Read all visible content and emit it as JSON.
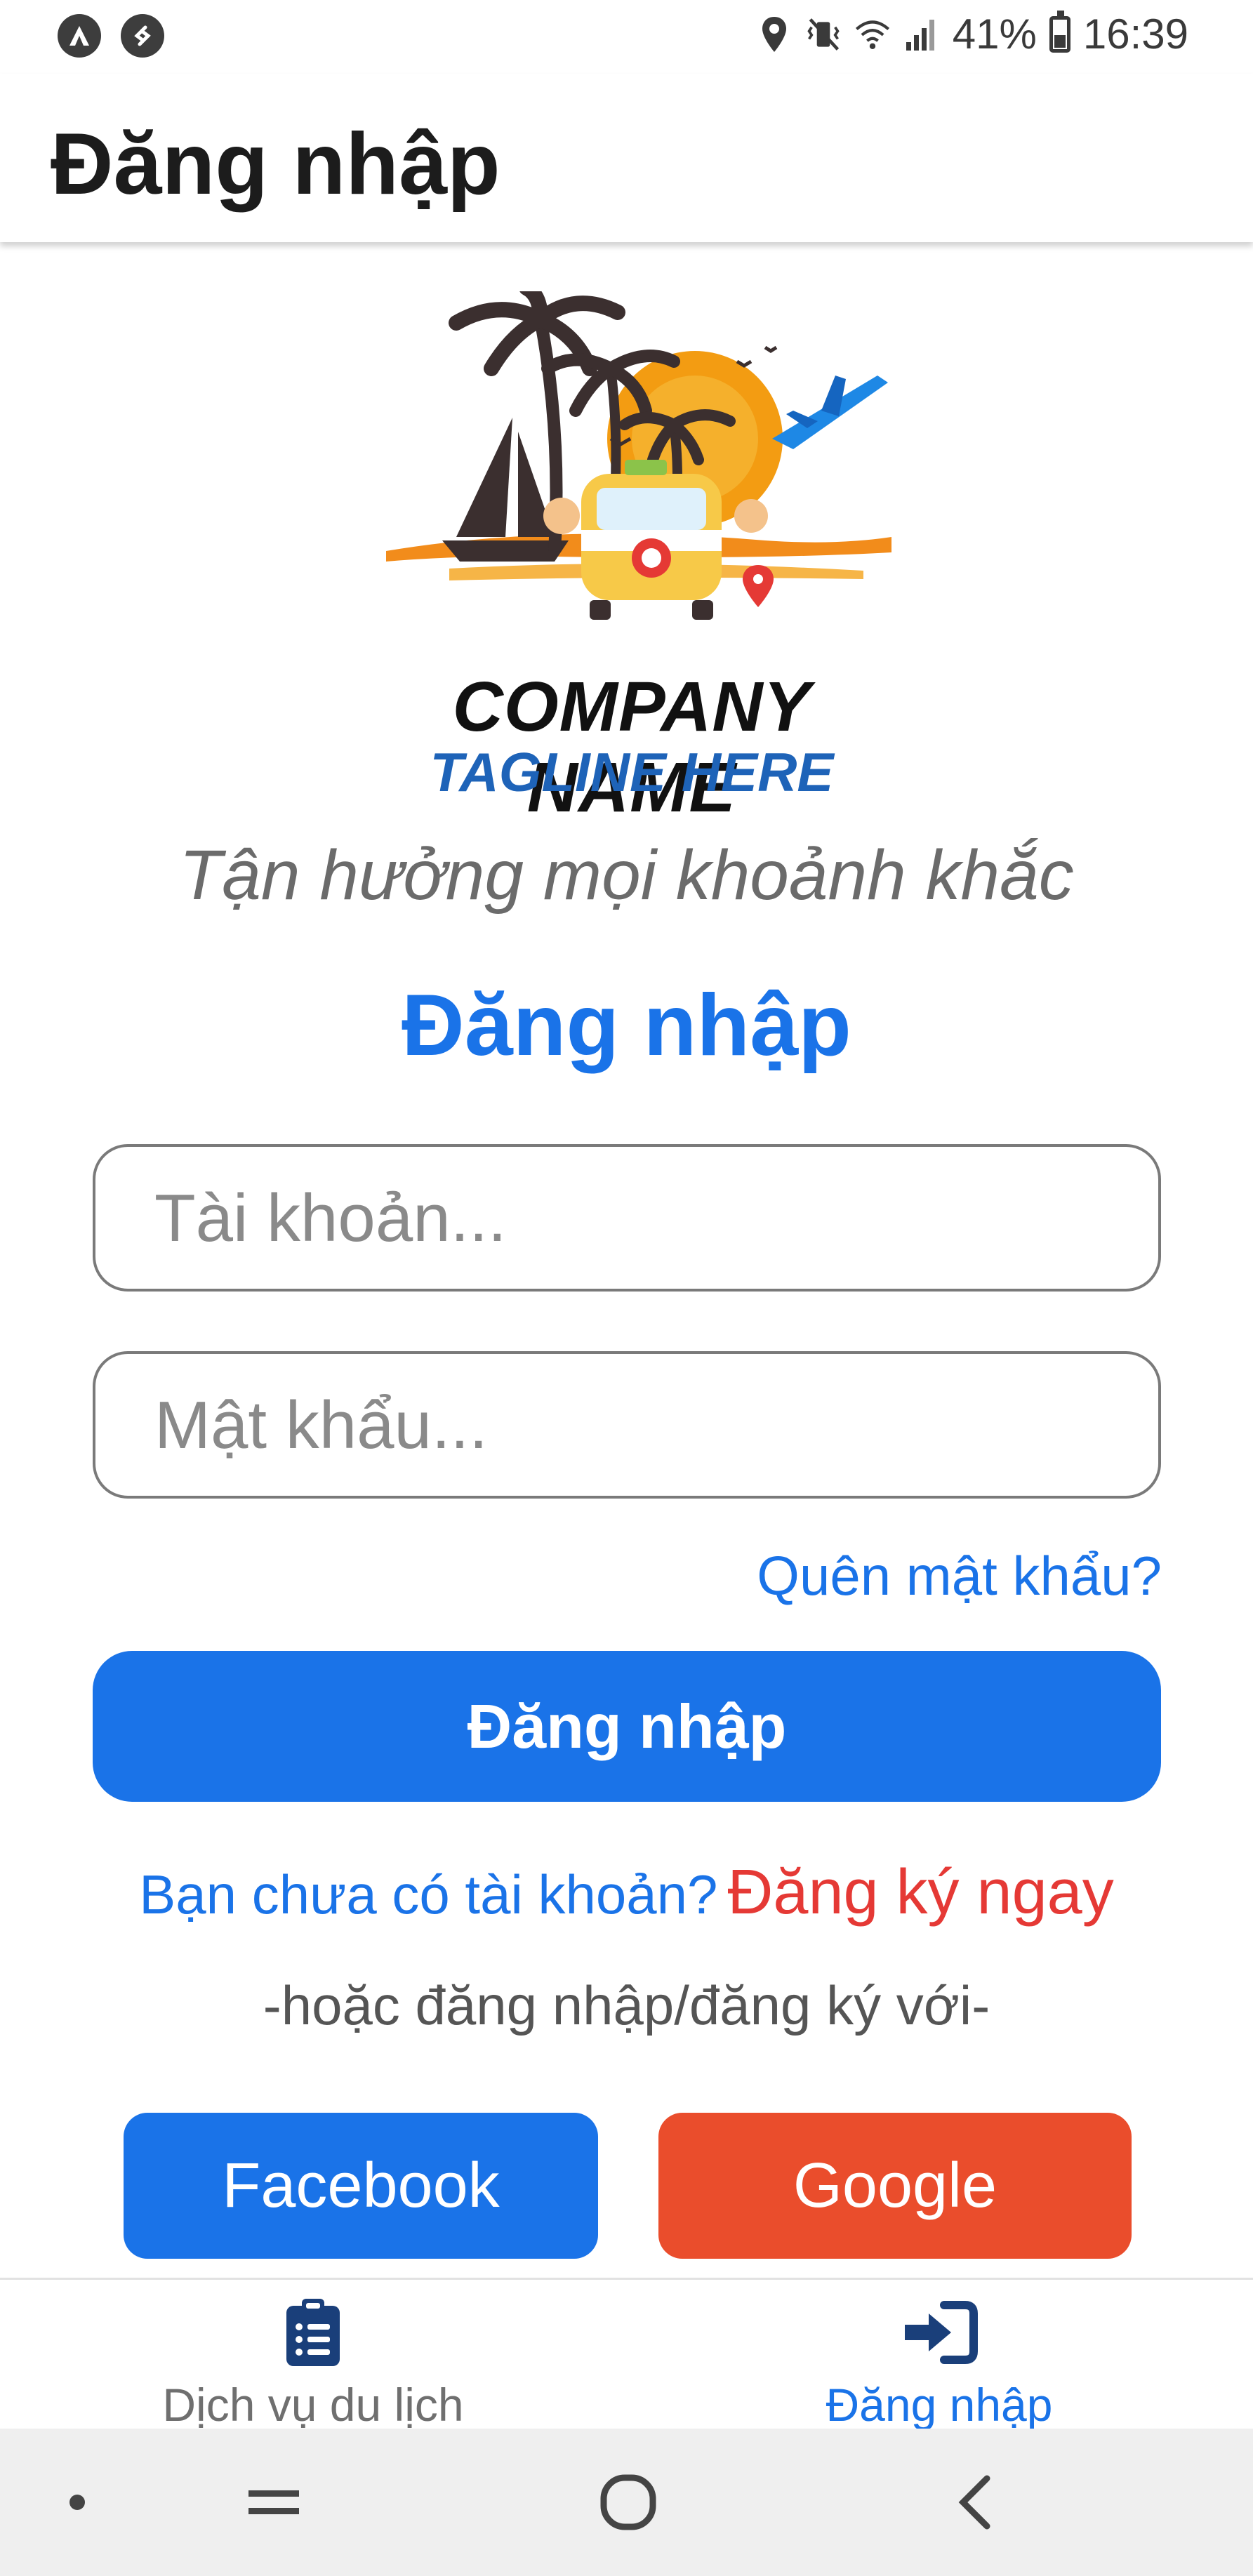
{
  "status_bar": {
    "left_icons": [
      "assistant-icon",
      "shazam-icon"
    ],
    "right_icons": [
      "location-icon",
      "vibrate-icon",
      "wifi-icon",
      "signal-icon"
    ],
    "battery": "41%",
    "battery_level": 0.41,
    "time": "16:39"
  },
  "app_bar": {
    "title": "Đăng nhập"
  },
  "logo": {
    "company": "COMPANY NAME",
    "tagline": "TAGLINE HERE"
  },
  "slogan": "Tận hưởng mọi khoảnh khắc",
  "heading": "Đăng nhập",
  "form": {
    "username": {
      "value": "",
      "placeholder": "Tài khoản..."
    },
    "password": {
      "value": "",
      "placeholder": "Mật khẩu..."
    },
    "forgot": "Quên mật khẩu?",
    "submit": "Đăng nhập",
    "register_question": "Bạn chưa có tài khoản?",
    "register_link": "Đăng ký ngay",
    "or_text": "-hoặc đăng nhập/đăng ký với-"
  },
  "social": {
    "facebook": "Facebook",
    "google": "Google"
  },
  "bottom_nav": {
    "items": [
      {
        "label": "Dịch vụ du lịch",
        "icon": "clipboard-list-icon",
        "active": false
      },
      {
        "label": "Đăng nhập",
        "icon": "sign-in-icon",
        "active": true
      }
    ]
  },
  "colors": {
    "primary": "#1a73e8",
    "google": "#ea4d2c",
    "register": "#e53935"
  }
}
